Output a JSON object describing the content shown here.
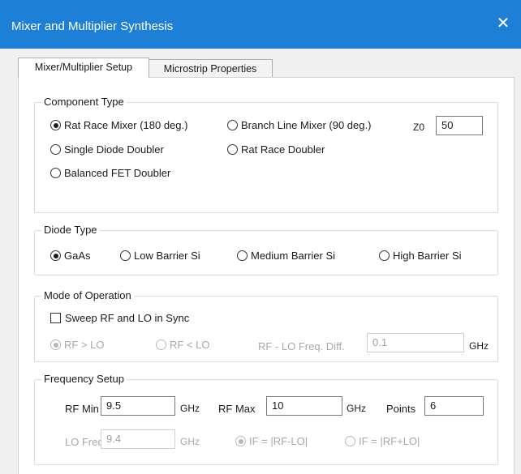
{
  "window": {
    "title": "Mixer and Multiplier Synthesis",
    "close_glyph": "✕"
  },
  "tabs": [
    {
      "label": "Mixer/Multiplier Setup",
      "active": true
    },
    {
      "label": "Microstrip Properties",
      "active": false
    }
  ],
  "component_type": {
    "legend": "Component Type",
    "options": [
      {
        "label": "Rat Race Mixer (180 deg.)",
        "selected": true
      },
      {
        "label": "Branch Line Mixer (90 deg.)",
        "selected": false
      },
      {
        "label": "Single Diode Doubler",
        "selected": false
      },
      {
        "label": "Rat Race Doubler",
        "selected": false
      },
      {
        "label": "Balanced FET Doubler",
        "selected": false
      }
    ],
    "z0_label": "Z0",
    "z0_value": "50"
  },
  "diode_type": {
    "legend": "Diode Type",
    "options": [
      {
        "label": "GaAs",
        "selected": true
      },
      {
        "label": "Low Barrier Si",
        "selected": false
      },
      {
        "label": "Medium Barrier Si",
        "selected": false
      },
      {
        "label": "High Barrier Si",
        "selected": false
      }
    ]
  },
  "mode_of_operation": {
    "legend": "Mode of Operation",
    "sweep_label": "Sweep RF and LO in Sync",
    "sweep_checked": false,
    "rf_gt_lo": "RF > LO",
    "rf_lt_lo": "RF < LO",
    "freq_diff_label": "RF - LO Freq. Diff.",
    "freq_diff_value": "0.1",
    "freq_diff_unit": "GHz"
  },
  "frequency_setup": {
    "legend": "Frequency Setup",
    "rf_min_label": "RF Min",
    "rf_min_value": "9.5",
    "rf_min_unit": "GHz",
    "rf_max_label": "RF Max",
    "rf_max_value": "10",
    "rf_max_unit": "GHz",
    "points_label": "Points",
    "points_value": "6",
    "lo_freq_label": "LO Freq.",
    "lo_freq_value": "9.4",
    "lo_freq_unit": "GHz",
    "if_minus_label": "IF = |RF-LO|",
    "if_plus_label": "IF = |RF+LO|"
  }
}
